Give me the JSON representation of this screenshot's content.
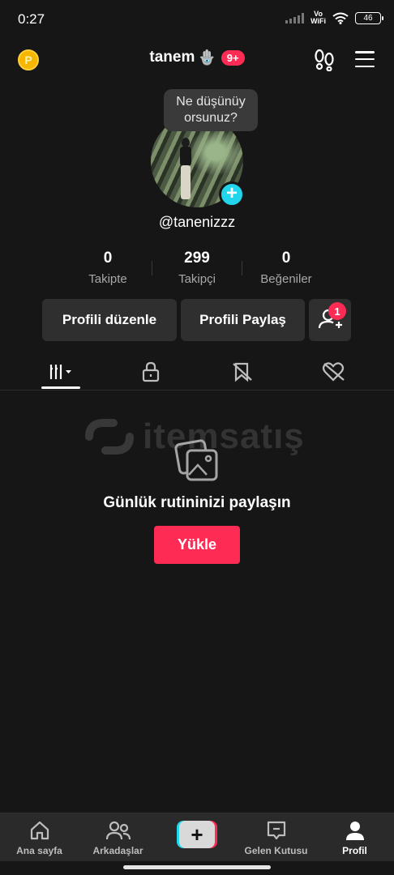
{
  "status_bar": {
    "time": "0:27",
    "network": "Vo\nWiFi",
    "battery": "46"
  },
  "header": {
    "username": "tanem",
    "username_emoji": "🪬",
    "notification_count": "9+"
  },
  "profile": {
    "bubble_text": "Ne düşünüy orsunuz?",
    "handle": "@tanenizzz",
    "stats": [
      {
        "value": "0",
        "label": "Takipte"
      },
      {
        "value": "299",
        "label": "Takipçi"
      },
      {
        "value": "0",
        "label": "Beğeniler"
      }
    ],
    "edit_label": "Profili düzenle",
    "share_label": "Profili Paylaş",
    "friend_requests": "1"
  },
  "tabs": [
    {
      "icon": "grid-icon",
      "active": true
    },
    {
      "icon": "lock-icon",
      "active": false
    },
    {
      "icon": "bookmark-icon",
      "active": false
    },
    {
      "icon": "liked-heart-icon",
      "active": false
    }
  ],
  "empty_state": {
    "watermark": "itemsatış",
    "message": "Günlük rutininizi paylaşın",
    "upload_label": "Yükle"
  },
  "bottom_nav": [
    {
      "label": "Ana sayfa",
      "icon": "home-icon"
    },
    {
      "label": "Arkadaşlar",
      "icon": "friends-icon"
    },
    {
      "label": "",
      "icon": "create-plus-icon"
    },
    {
      "label": "Gelen Kutusu",
      "icon": "inbox-icon"
    },
    {
      "label": "Profil",
      "icon": "profile-icon",
      "active": true
    }
  ],
  "colors": {
    "accent": "#fe2c55",
    "cyan": "#20d5ec",
    "background": "#161616",
    "coin": "#f6b500"
  }
}
